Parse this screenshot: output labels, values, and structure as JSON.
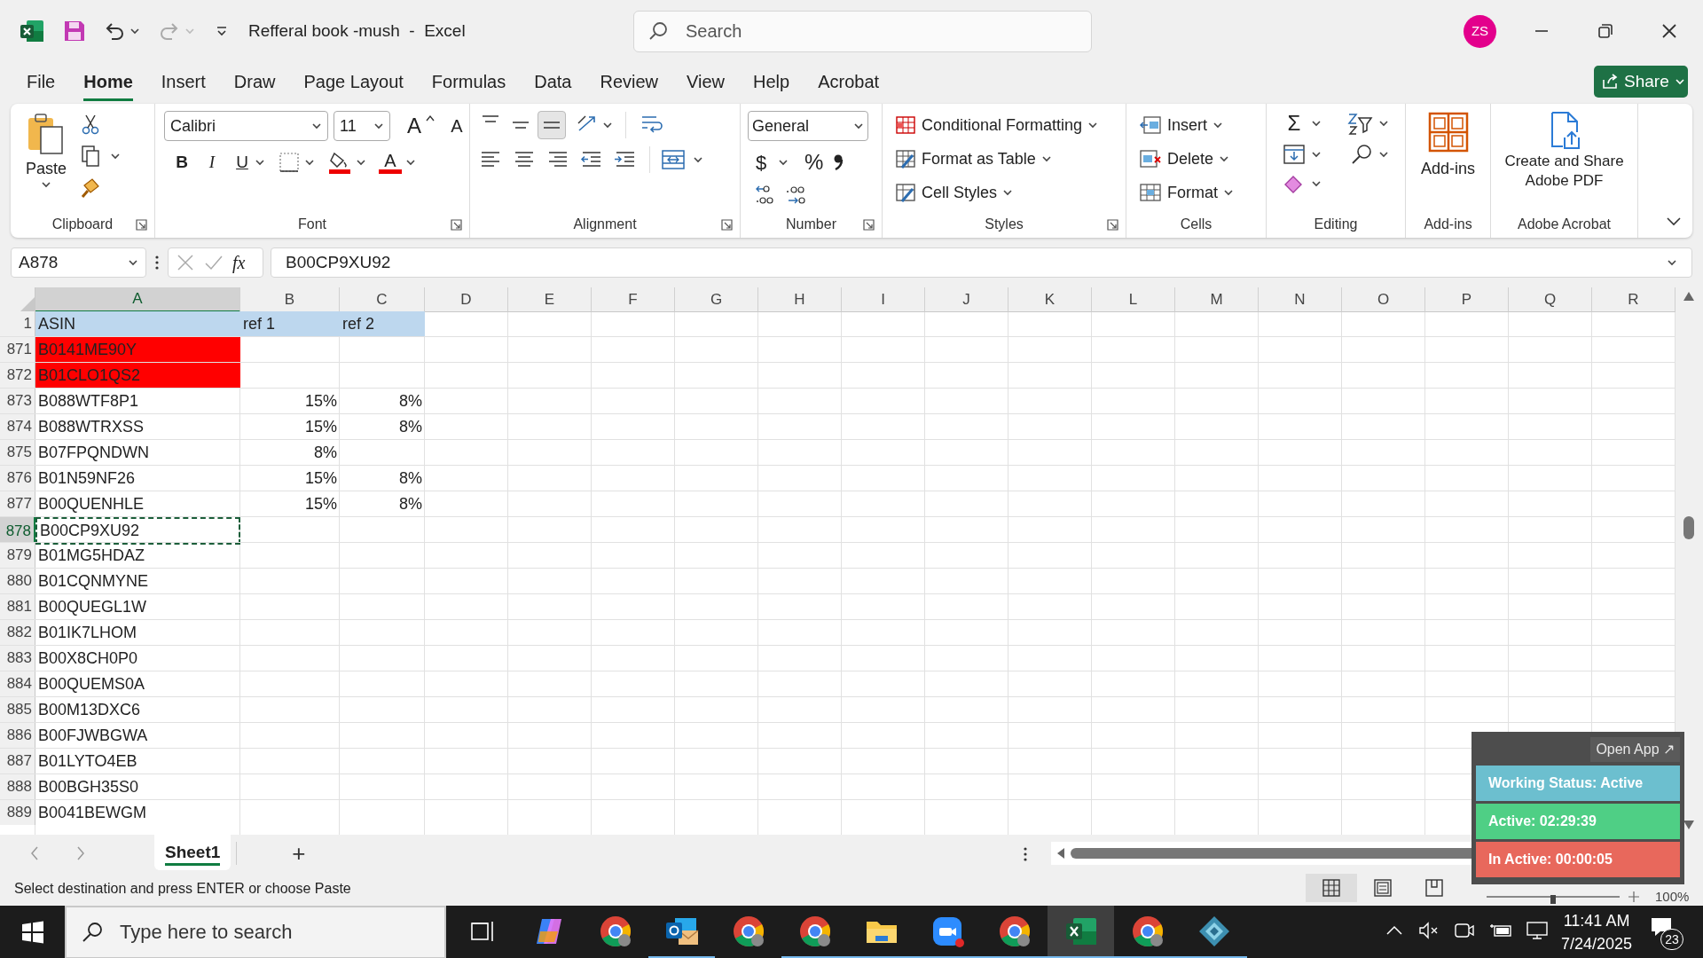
{
  "title_bar": {
    "document": "Refferal book -mush  -  Excel",
    "search_placeholder": "Search",
    "avatar": "ZS"
  },
  "menu_tabs": [
    {
      "label": "File",
      "selected": false
    },
    {
      "label": "Home",
      "selected": true
    },
    {
      "label": "Insert",
      "selected": false
    },
    {
      "label": "Draw",
      "selected": false
    },
    {
      "label": "Page Layout",
      "selected": false
    },
    {
      "label": "Formulas",
      "selected": false
    },
    {
      "label": "Data",
      "selected": false
    },
    {
      "label": "Review",
      "selected": false
    },
    {
      "label": "View",
      "selected": false
    },
    {
      "label": "Help",
      "selected": false
    },
    {
      "label": "Acrobat",
      "selected": false
    }
  ],
  "share_button": "Share",
  "ribbon": {
    "clipboard": {
      "label": "Clipboard",
      "paste": "Paste"
    },
    "font": {
      "label": "Font",
      "font_name": "Calibri",
      "font_size": "11",
      "grow": "A",
      "shrink": "A",
      "bold": "B",
      "italic": "I",
      "underline": "U",
      "font_color": "A"
    },
    "alignment": {
      "label": "Alignment"
    },
    "number": {
      "label": "Number",
      "format": "General",
      "currency": "$",
      "percent": "%"
    },
    "styles": {
      "label": "Styles",
      "buttons": [
        "Conditional Formatting",
        "Format as Table",
        "Cell Styles"
      ]
    },
    "cells": {
      "label": "Cells",
      "buttons": [
        "Insert",
        "Delete",
        "Format"
      ]
    },
    "editing": {
      "label": "Editing",
      "autosum": "Σ"
    },
    "addins": {
      "label": "Add-ins",
      "button": "Add-ins"
    },
    "acrobat": {
      "label": "Adobe Acrobat",
      "button": "Create and Share Adobe PDF"
    }
  },
  "formula_bar": {
    "name_box": "A878",
    "fx": "fx",
    "formula": "B00CP9XU92"
  },
  "sheet": {
    "columns": [
      {
        "label": "A",
        "selected": true
      },
      {
        "label": "B",
        "selected": false
      },
      {
        "label": "C",
        "selected": false
      },
      {
        "label": "D",
        "selected": false
      },
      {
        "label": "E",
        "selected": false
      },
      {
        "label": "F",
        "selected": false
      },
      {
        "label": "G",
        "selected": false
      },
      {
        "label": "H",
        "selected": false
      },
      {
        "label": "I",
        "selected": false
      },
      {
        "label": "J",
        "selected": false
      },
      {
        "label": "K",
        "selected": false
      },
      {
        "label": "L",
        "selected": false
      },
      {
        "label": "M",
        "selected": false
      },
      {
        "label": "N",
        "selected": false
      },
      {
        "label": "O",
        "selected": false
      },
      {
        "label": "P",
        "selected": false
      },
      {
        "label": "Q",
        "selected": false
      },
      {
        "label": "R",
        "selected": false
      }
    ],
    "rows": [
      {
        "number": "1",
        "kind": "header",
        "selected": false,
        "color": "#bdd7ee",
        "cells": [
          "ASIN",
          "ref 1",
          "ref 2"
        ]
      },
      {
        "number": "871",
        "kind": "data",
        "selected": false,
        "color": "#ff0000",
        "cells": [
          "B0141ME90Y",
          null,
          null
        ]
      },
      {
        "number": "872",
        "kind": "data",
        "selected": false,
        "color": "#ff0000",
        "cells": [
          "B01CLO1QS2",
          null,
          null
        ]
      },
      {
        "number": "873",
        "kind": "data",
        "selected": false,
        "cells": [
          "B088WTF8P1",
          "15%",
          "8%"
        ]
      },
      {
        "number": "874",
        "kind": "data",
        "selected": false,
        "cells": [
          "B088WTRXSS",
          "15%",
          "8%"
        ]
      },
      {
        "number": "875",
        "kind": "data",
        "selected": false,
        "cells": [
          "B07FPQNDWN",
          "8%",
          null
        ]
      },
      {
        "number": "876",
        "kind": "data",
        "selected": false,
        "cells": [
          "B01N59NF26",
          "15%",
          "8%"
        ]
      },
      {
        "number": "877",
        "kind": "data",
        "selected": false,
        "cells": [
          "B00QUENHLE",
          "15%",
          "8%"
        ]
      },
      {
        "number": "878",
        "kind": "data",
        "selected": true,
        "cells": [
          "B00CP9XU92",
          null,
          null
        ]
      },
      {
        "number": "879",
        "kind": "data",
        "selected": false,
        "cells": [
          "B01MG5HDAZ",
          null,
          null
        ]
      },
      {
        "number": "880",
        "kind": "data",
        "selected": false,
        "cells": [
          "B01CQNMYNE",
          null,
          null
        ]
      },
      {
        "number": "881",
        "kind": "data",
        "selected": false,
        "cells": [
          "B00QUEGL1W",
          null,
          null
        ]
      },
      {
        "number": "882",
        "kind": "data",
        "selected": false,
        "cells": [
          "B01IK7LHOM",
          null,
          null
        ]
      },
      {
        "number": "883",
        "kind": "data",
        "selected": false,
        "cells": [
          "B00X8CH0P0",
          null,
          null
        ]
      },
      {
        "number": "884",
        "kind": "data",
        "selected": false,
        "cells": [
          "B00QUEMS0A",
          null,
          null
        ]
      },
      {
        "number": "885",
        "kind": "data",
        "selected": false,
        "cells": [
          "B00M13DXC6",
          null,
          null
        ]
      },
      {
        "number": "886",
        "kind": "data",
        "selected": false,
        "cells": [
          "B00FJWBGWA",
          null,
          null
        ]
      },
      {
        "number": "887",
        "kind": "data",
        "selected": false,
        "cells": [
          "B01LYTO4EB",
          null,
          null
        ]
      },
      {
        "number": "888",
        "kind": "data",
        "selected": false,
        "cells": [
          "B00BGH35S0",
          null,
          null
        ]
      },
      {
        "number": "889",
        "kind": "data",
        "selected": false,
        "cells": [
          "B0041BEWGM",
          null,
          null
        ]
      }
    ]
  },
  "sheet_tabs": [
    {
      "label": "Sheet1",
      "selected": true
    }
  ],
  "new_sheet": "+",
  "status_bar": {
    "message": "Select destination and press ENTER or choose Paste",
    "zoom_slider": {
      "level": 0.5
    },
    "zoom": "100%"
  },
  "tracker_widget": {
    "open_app": "Open App ↗",
    "statuses": [
      {
        "text": "Working Status: Active",
        "color": "#6cbfcf"
      },
      {
        "text": "Active: 02:29:39",
        "color": "#4fcf85"
      },
      {
        "text": "In Active: 00:00:05",
        "color": "#e8685c"
      }
    ]
  },
  "taskbar": {
    "search_placeholder": "Type here to search",
    "time": "11:41 AM",
    "date": "7/24/2025",
    "notifications": "23",
    "apps": [
      {
        "kind": "taskview",
        "running": false,
        "selected": false
      },
      {
        "kind": "copilot",
        "running": false,
        "selected": false
      },
      {
        "kind": "chrome",
        "running": false,
        "selected": false
      },
      {
        "kind": "outlook",
        "running": true,
        "selected": false
      },
      {
        "kind": "chrome",
        "running": false,
        "selected": false
      },
      {
        "kind": "chrome",
        "running": true,
        "selected": false
      },
      {
        "kind": "explorer",
        "running": true,
        "selected": false
      },
      {
        "kind": "zoom",
        "running": true,
        "selected": false
      },
      {
        "kind": "chrome",
        "running": true,
        "selected": false
      },
      {
        "kind": "excel",
        "running": true,
        "selected": true
      },
      {
        "kind": "chrome",
        "running": true,
        "selected": false
      },
      {
        "kind": "diamond",
        "running": true,
        "selected": false
      }
    ]
  }
}
